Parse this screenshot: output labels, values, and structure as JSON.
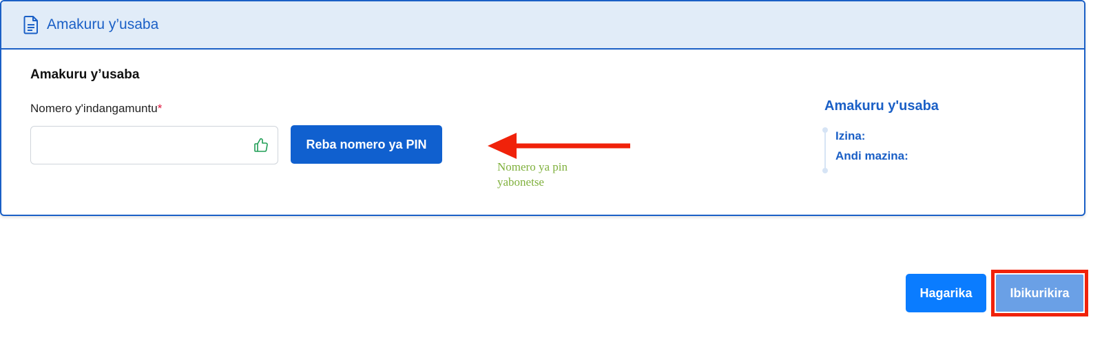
{
  "panel": {
    "header_title": "Amakuru y’usaba",
    "header_icon": "document-icon",
    "section_title": "Amakuru y’usaba",
    "id_field": {
      "label": "Nomero y'indangamuntu",
      "required_mark": "*",
      "value": "",
      "status_icon": "thumbs-up-icon"
    },
    "pin_button_label": "Reba nomero ya PIN"
  },
  "annotation": {
    "arrow_color": "#f0220a",
    "note_line1": "Nomero ya pin",
    "note_line2": "yabonetse",
    "note_color": "#7fb03c"
  },
  "summary": {
    "title": "Amakuru y'usaba",
    "names_label": "Izina:",
    "other_names_label": "Andi mazina:"
  },
  "footer": {
    "cancel_label": "Hagarika",
    "next_label": "Ibikurikira",
    "highlight_color": "#f0220a"
  },
  "colors": {
    "primary": "#1060cf",
    "header_bg": "#e1ecf8",
    "required": "#e0143c",
    "thumb": "#1f9d55"
  }
}
